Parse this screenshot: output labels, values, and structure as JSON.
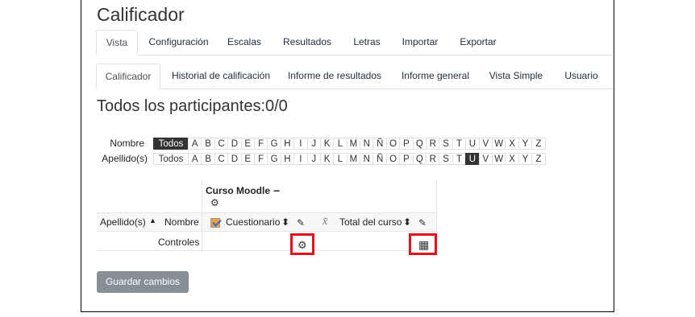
{
  "page": {
    "title": "Calificador",
    "subtitle": "Todos los participantes:0/0"
  },
  "nav_primary": [
    "Vista",
    "Configuración",
    "Escalas",
    "Resultados",
    "Letras",
    "Importar",
    "Exportar"
  ],
  "nav_secondary": [
    "Calificador",
    "Historial de calificación",
    "Informe de resultados",
    "Informe general",
    "Vista Simple",
    "Usuario"
  ],
  "initials": {
    "first_label": "Nombre",
    "last_label": "Apellido(s)",
    "all_label": "Todos",
    "letters": [
      "A",
      "B",
      "C",
      "D",
      "E",
      "F",
      "G",
      "H",
      "I",
      "J",
      "K",
      "L",
      "M",
      "N",
      "Ñ",
      "O",
      "P",
      "Q",
      "R",
      "S",
      "T",
      "U",
      "V",
      "W",
      "X",
      "Y",
      "Z"
    ],
    "first_selected": "Todos",
    "last_selected": "U"
  },
  "grader": {
    "category": "Curso Moodle",
    "collapse_symbol": "−",
    "col_lastname": "Apellido(s)",
    "col_firstname": "Nombre",
    "col_item1": "Cuestionario",
    "col_item2": "Total del curso",
    "controls_label": "Controles",
    "sort_asc": "▲",
    "sort_both": "⬍"
  },
  "icons": {
    "gear": "⚙",
    "edit": "✎",
    "calculator": "▦",
    "xbar": "x̄"
  },
  "colors": {
    "highlight_box": "#e0141e",
    "selected_letter": "#333333",
    "button": "#868e96"
  },
  "actions": {
    "save_label": "Guardar cambios"
  }
}
